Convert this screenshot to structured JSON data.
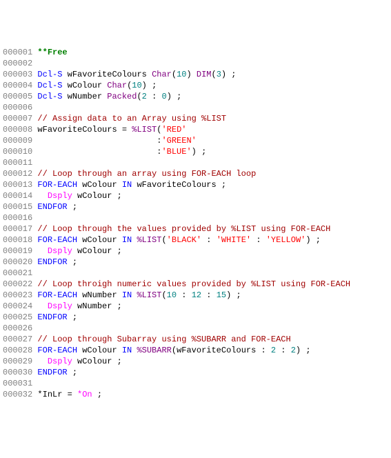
{
  "lines": [
    {
      "no": "000001",
      "tokens": [
        [
          "green bold",
          "**Free"
        ]
      ]
    },
    {
      "no": "000002",
      "tokens": []
    },
    {
      "no": "000003",
      "tokens": [
        [
          "blue",
          "Dcl-S"
        ],
        [
          "black",
          " wFavoriteColours "
        ],
        [
          "purple",
          "Char"
        ],
        [
          "black",
          "("
        ],
        [
          "teal",
          "10"
        ],
        [
          "black",
          ") "
        ],
        [
          "purple",
          "DIM"
        ],
        [
          "black",
          "("
        ],
        [
          "teal",
          "3"
        ],
        [
          "black",
          ") ;"
        ]
      ]
    },
    {
      "no": "000004",
      "tokens": [
        [
          "blue",
          "Dcl-S"
        ],
        [
          "black",
          " wColour "
        ],
        [
          "purple",
          "Char"
        ],
        [
          "black",
          "("
        ],
        [
          "teal",
          "10"
        ],
        [
          "black",
          ") ;"
        ]
      ]
    },
    {
      "no": "000005",
      "tokens": [
        [
          "blue",
          "Dcl-S"
        ],
        [
          "black",
          " wNumber "
        ],
        [
          "purple",
          "Packed"
        ],
        [
          "black",
          "("
        ],
        [
          "teal",
          "2"
        ],
        [
          "black",
          " : "
        ],
        [
          "teal",
          "0"
        ],
        [
          "black",
          ") ;"
        ]
      ]
    },
    {
      "no": "000006",
      "tokens": []
    },
    {
      "no": "000007",
      "tokens": [
        [
          "darkred",
          "// Assign data to an Array using %LIST"
        ]
      ]
    },
    {
      "no": "000008",
      "tokens": [
        [
          "black",
          "wFavoriteColours = "
        ],
        [
          "purple",
          "%LIST"
        ],
        [
          "black",
          "("
        ],
        [
          "red",
          "'RED'"
        ]
      ]
    },
    {
      "no": "000009",
      "tokens": [
        [
          "black",
          "                        :"
        ],
        [
          "red",
          "'GREEN'"
        ]
      ]
    },
    {
      "no": "000010",
      "tokens": [
        [
          "black",
          "                        :"
        ],
        [
          "red",
          "'BLUE'"
        ],
        [
          "black",
          ") ;"
        ]
      ]
    },
    {
      "no": "000011",
      "tokens": []
    },
    {
      "no": "000012",
      "tokens": [
        [
          "darkred",
          "// Loop through an array using FOR-EACH loop"
        ]
      ]
    },
    {
      "no": "000013",
      "tokens": [
        [
          "blue",
          "FOR-EACH"
        ],
        [
          "black",
          " wColour "
        ],
        [
          "blue",
          "IN"
        ],
        [
          "black",
          " wFavoriteColours ;"
        ]
      ]
    },
    {
      "no": "000014",
      "tokens": [
        [
          "black",
          "  "
        ],
        [
          "hotpink",
          "Dsply"
        ],
        [
          "black",
          " wColour ;"
        ]
      ]
    },
    {
      "no": "000015",
      "tokens": [
        [
          "blue",
          "ENDFOR"
        ],
        [
          "black",
          " ;"
        ]
      ]
    },
    {
      "no": "000016",
      "tokens": []
    },
    {
      "no": "000017",
      "tokens": [
        [
          "darkred",
          "// Loop through the values provided by %LIST using FOR-EACH"
        ]
      ]
    },
    {
      "no": "000018",
      "tokens": [
        [
          "blue",
          "FOR-EACH"
        ],
        [
          "black",
          " wColour "
        ],
        [
          "blue",
          "IN"
        ],
        [
          "black",
          " "
        ],
        [
          "purple",
          "%LIST"
        ],
        [
          "black",
          "("
        ],
        [
          "red",
          "'BLACK'"
        ],
        [
          "black",
          " : "
        ],
        [
          "red",
          "'WHITE'"
        ],
        [
          "black",
          " : "
        ],
        [
          "red",
          "'YELLOW'"
        ],
        [
          "black",
          ") ;"
        ]
      ]
    },
    {
      "no": "000019",
      "tokens": [
        [
          "black",
          "  "
        ],
        [
          "hotpink",
          "Dsply"
        ],
        [
          "black",
          " wColour ;"
        ]
      ]
    },
    {
      "no": "000020",
      "tokens": [
        [
          "blue",
          "ENDFOR"
        ],
        [
          "black",
          " ;"
        ]
      ]
    },
    {
      "no": "000021",
      "tokens": []
    },
    {
      "no": "000022",
      "tokens": [
        [
          "darkred",
          "// Loop throigh numeric values provided by %LIST using FOR-EACH"
        ]
      ]
    },
    {
      "no": "000023",
      "tokens": [
        [
          "blue",
          "FOR-EACH"
        ],
        [
          "black",
          " wNumber "
        ],
        [
          "blue",
          "IN"
        ],
        [
          "black",
          " "
        ],
        [
          "purple",
          "%LIST"
        ],
        [
          "black",
          "("
        ],
        [
          "teal",
          "10"
        ],
        [
          "black",
          " : "
        ],
        [
          "teal",
          "12"
        ],
        [
          "black",
          " : "
        ],
        [
          "teal",
          "15"
        ],
        [
          "black",
          ") ;"
        ]
      ]
    },
    {
      "no": "000024",
      "tokens": [
        [
          "black",
          "  "
        ],
        [
          "hotpink",
          "Dsply"
        ],
        [
          "black",
          " wNumber ;"
        ]
      ]
    },
    {
      "no": "000025",
      "tokens": [
        [
          "blue",
          "ENDFOR"
        ],
        [
          "black",
          " ;"
        ]
      ]
    },
    {
      "no": "000026",
      "tokens": []
    },
    {
      "no": "000027",
      "tokens": [
        [
          "darkred",
          "// Loop through Subarray using %SUBARR and FOR-EACH"
        ]
      ]
    },
    {
      "no": "000028",
      "tokens": [
        [
          "blue",
          "FOR-EACH"
        ],
        [
          "black",
          " wColour "
        ],
        [
          "blue",
          "IN"
        ],
        [
          "black",
          " "
        ],
        [
          "purple",
          "%SUBARR"
        ],
        [
          "black",
          "(wFavoriteColours : "
        ],
        [
          "teal",
          "2"
        ],
        [
          "black",
          " : "
        ],
        [
          "teal",
          "2"
        ],
        [
          "black",
          ") ;"
        ]
      ]
    },
    {
      "no": "000029",
      "tokens": [
        [
          "black",
          "  "
        ],
        [
          "hotpink",
          "Dsply"
        ],
        [
          "black",
          " wColour ;"
        ]
      ]
    },
    {
      "no": "000030",
      "tokens": [
        [
          "blue",
          "ENDFOR"
        ],
        [
          "black",
          " ;"
        ]
      ]
    },
    {
      "no": "000031",
      "tokens": []
    },
    {
      "no": "000032",
      "tokens": [
        [
          "black",
          "*InLr = "
        ],
        [
          "hotpink",
          "*On"
        ],
        [
          "black",
          " ;"
        ]
      ]
    }
  ]
}
